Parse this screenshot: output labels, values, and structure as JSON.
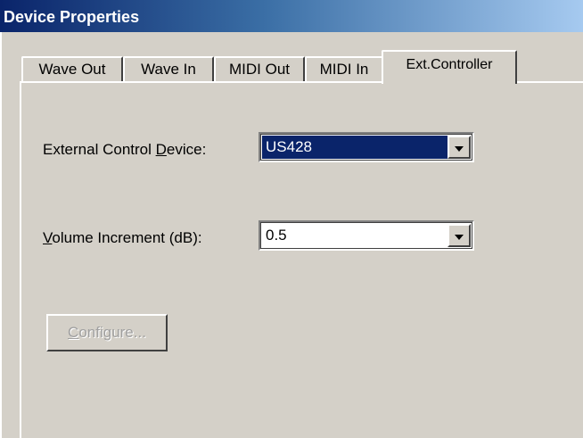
{
  "window": {
    "title": "Device Properties"
  },
  "tabs": [
    {
      "label": "Wave Out"
    },
    {
      "label": "Wave In"
    },
    {
      "label": "MIDI Out"
    },
    {
      "label": "MIDI In"
    },
    {
      "label": "Ext.Controller"
    }
  ],
  "active_tab": "Ext.Controller",
  "fields": {
    "external_control_device": {
      "label_prefix": "External Control ",
      "label_mnemonic": "D",
      "label_suffix": "evice:",
      "value": "US428"
    },
    "volume_increment": {
      "label_mnemonic": "V",
      "label_suffix": "olume Increment (dB):",
      "value": "0.5"
    }
  },
  "configure_button": {
    "mnemonic": "C",
    "label_suffix": "onfigure...",
    "enabled": false
  },
  "colors": {
    "face": "#d4d0c8",
    "title_start": "#0a246a",
    "selection": "#0a246a",
    "disabled_text": "#a0a0a0"
  }
}
